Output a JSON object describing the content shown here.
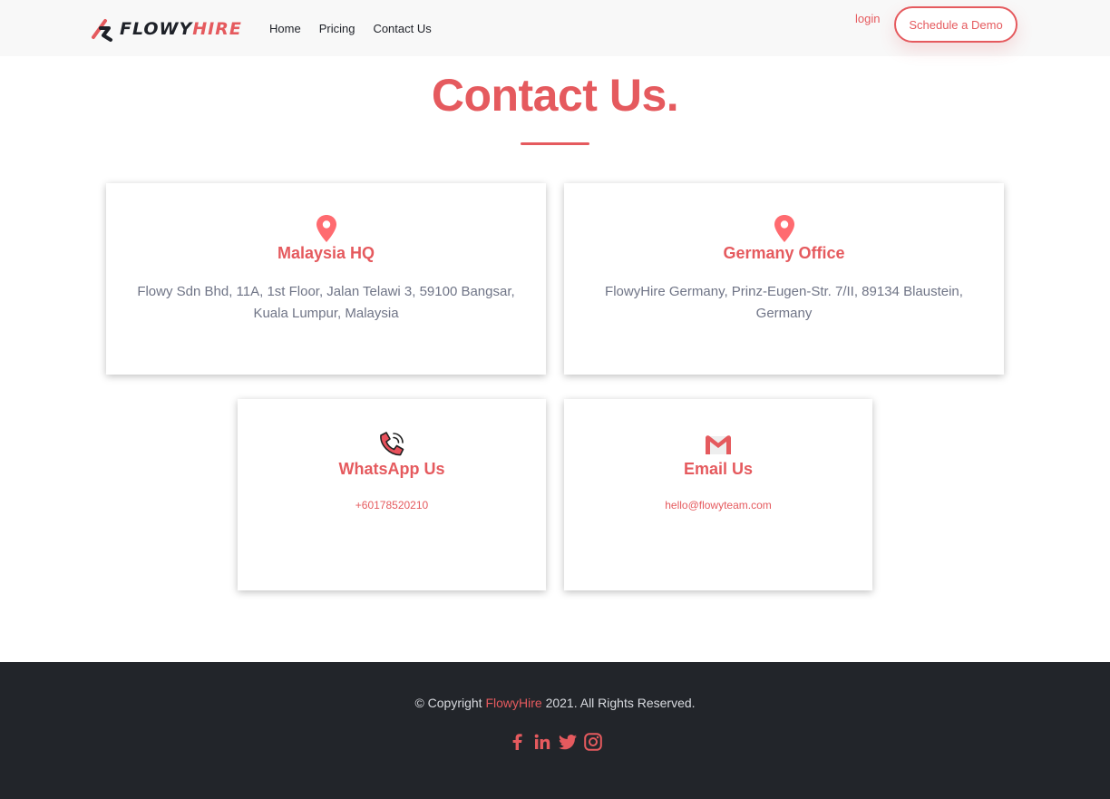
{
  "header": {
    "logo": {
      "part1": "FLOWY",
      "part2": "HIRE"
    },
    "nav": [
      {
        "label": "Home"
      },
      {
        "label": "Pricing"
      },
      {
        "label": "Contact Us"
      }
    ],
    "login_label": "login",
    "demo_label": "Schedule a Demo"
  },
  "main": {
    "title": "Contact Us.",
    "cards": [
      {
        "icon": "map-pin-icon",
        "heading": "Malaysia HQ",
        "text": "Flowy Sdn Bhd, 11A, 1st Floor, Jalan Telawi 3, 59100 Bangsar, Kuala Lumpur, Malaysia"
      },
      {
        "icon": "map-pin-icon",
        "heading": "Germany Office",
        "text": "FlowyHire Germany, Prinz-Eugen-Str. 7/II, 89134 Blaustein, Germany"
      },
      {
        "icon": "phone-icon",
        "heading": "WhatsApp Us",
        "text": "+60178520210"
      },
      {
        "icon": "gmail-icon",
        "heading": "Email Us",
        "text": "hello@flowyteam.com"
      }
    ]
  },
  "footer": {
    "copyright_prefix": "© Copyright ",
    "copyright_brand": "FlowyHire",
    "copyright_suffix": " 2021. All Rights Reserved.",
    "socials": [
      "facebook-icon",
      "linkedin-icon",
      "twitter-icon",
      "instagram-icon"
    ]
  },
  "colors": {
    "accent": "#e55a5e",
    "footer_bg": "#22252a",
    "header_bg": "#f8f8f8",
    "body_text": "#6f7486"
  }
}
